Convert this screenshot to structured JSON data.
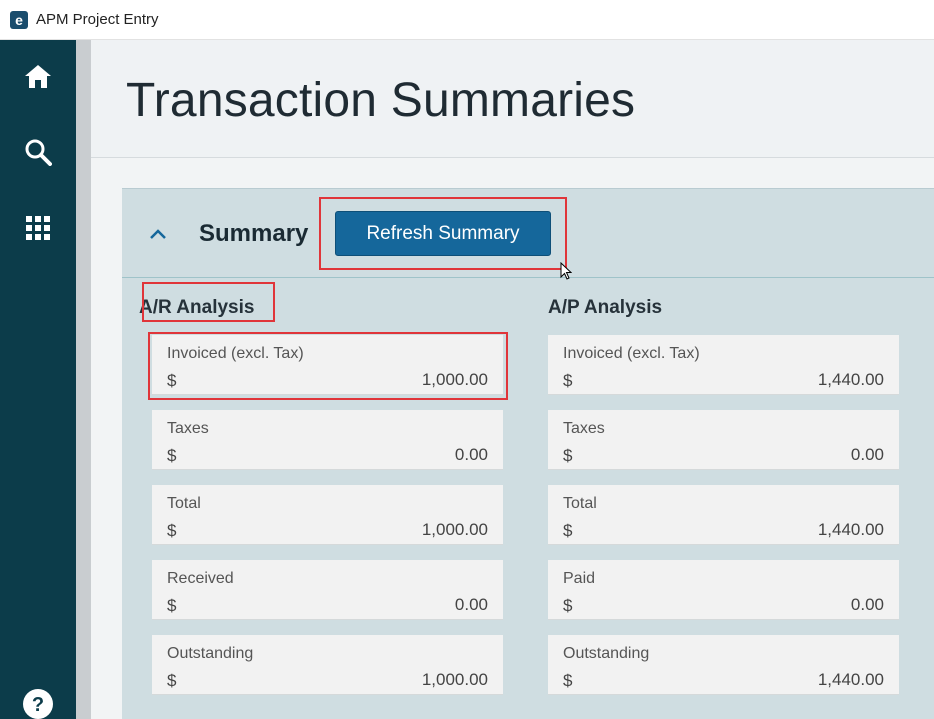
{
  "window": {
    "title": "APM Project Entry",
    "logo_letter": "e"
  },
  "rail": {
    "icons": [
      "home-icon",
      "search-icon",
      "apps-grid-icon",
      "help-icon"
    ]
  },
  "page": {
    "title": "Transaction Summaries"
  },
  "summary": {
    "title": "Summary",
    "refresh_label": "Refresh Summary",
    "ar": {
      "title": "A/R Analysis",
      "fields": [
        {
          "label": "Invoiced (excl. Tax)",
          "currency": "$",
          "value": "1,000.00"
        },
        {
          "label": "Taxes",
          "currency": "$",
          "value": "0.00"
        },
        {
          "label": "Total",
          "currency": "$",
          "value": "1,000.00"
        },
        {
          "label": "Received",
          "currency": "$",
          "value": "0.00"
        },
        {
          "label": "Outstanding",
          "currency": "$",
          "value": "1,000.00"
        }
      ]
    },
    "ap": {
      "title": "A/P Analysis",
      "fields": [
        {
          "label": "Invoiced (excl. Tax)",
          "currency": "$",
          "value": "1,440.00"
        },
        {
          "label": "Taxes",
          "currency": "$",
          "value": "0.00"
        },
        {
          "label": "Total",
          "currency": "$",
          "value": "1,440.00"
        },
        {
          "label": "Paid",
          "currency": "$",
          "value": "0.00"
        },
        {
          "label": "Outstanding",
          "currency": "$",
          "value": "1,440.00"
        }
      ]
    }
  },
  "colors": {
    "rail": "#0c3c4a",
    "button": "#15679b",
    "highlight": "#e0353a",
    "panel": "#cfdde1"
  }
}
